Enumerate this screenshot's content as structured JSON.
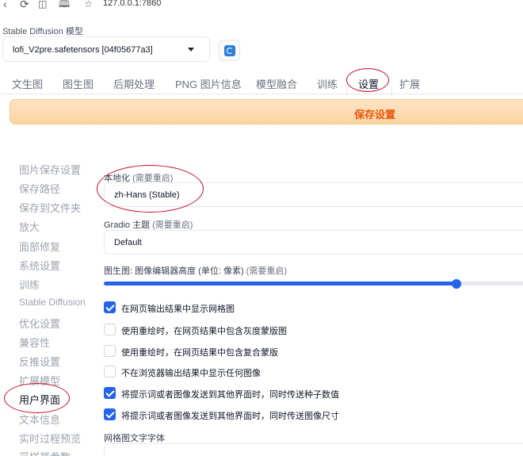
{
  "browser": {
    "url": "127.0.0.1:7860"
  },
  "model": {
    "label": "Stable Diffusion 模型",
    "value": "lofi_V2pre.safetensors [04f05677a3]"
  },
  "tabs": [
    {
      "label": "文生图"
    },
    {
      "label": "图生图"
    },
    {
      "label": "后期处理"
    },
    {
      "label": "PNG 图片信息"
    },
    {
      "label": "模型融合"
    },
    {
      "label": "训练"
    },
    {
      "label": "设置"
    },
    {
      "label": "扩展"
    }
  ],
  "save_button": "保存设置",
  "sidebar": [
    {
      "label": "图片保存设置"
    },
    {
      "label": "保存路径"
    },
    {
      "label": "保存到文件夹"
    },
    {
      "label": "放大"
    },
    {
      "label": "面部修复"
    },
    {
      "label": "系统设置"
    },
    {
      "label": "训练"
    },
    {
      "label": "Stable Diffusion"
    },
    {
      "label": "优化设置"
    },
    {
      "label": "兼容性"
    },
    {
      "label": "反推设置"
    },
    {
      "label": "扩展模型"
    },
    {
      "label": "用户界面"
    },
    {
      "label": "文本信息"
    },
    {
      "label": "实时过程预览"
    },
    {
      "label": "采样器参数"
    }
  ],
  "settings": {
    "localization": {
      "label": "本地化",
      "note": "(需要重启)",
      "value": "zh-Hans (Stable)"
    },
    "gradio_theme": {
      "label": "Gradio 主题",
      "note": "(需要重启)",
      "value": "Default"
    },
    "img2img_height": {
      "label": "图生图: 图像编辑器高度 (单位: 像素)",
      "note": "(需要重启)",
      "level": 0.82
    },
    "checkboxes": [
      {
        "label": "在网页输出结果中显示网格图",
        "checked": true
      },
      {
        "label": "使用重绘时，在网页结果中包含灰度蒙版图",
        "checked": false
      },
      {
        "label": "使用重绘时，在网页结果中包含复合蒙版",
        "checked": false
      },
      {
        "label": "不在浏览器输出结果中显示任何图像",
        "checked": false
      },
      {
        "label": "将提示词或者图像发送到其他界面时，同时传送种子数值",
        "checked": true
      },
      {
        "label": "将提示词或者图像发送到其他界面时，同时传送图像尺寸",
        "checked": true
      }
    ],
    "grid_font": {
      "label": "网格图文字字体"
    }
  },
  "colors": {
    "accent": "#2563eb",
    "save_text": "#ea580c",
    "annotation": "#c8102e"
  }
}
